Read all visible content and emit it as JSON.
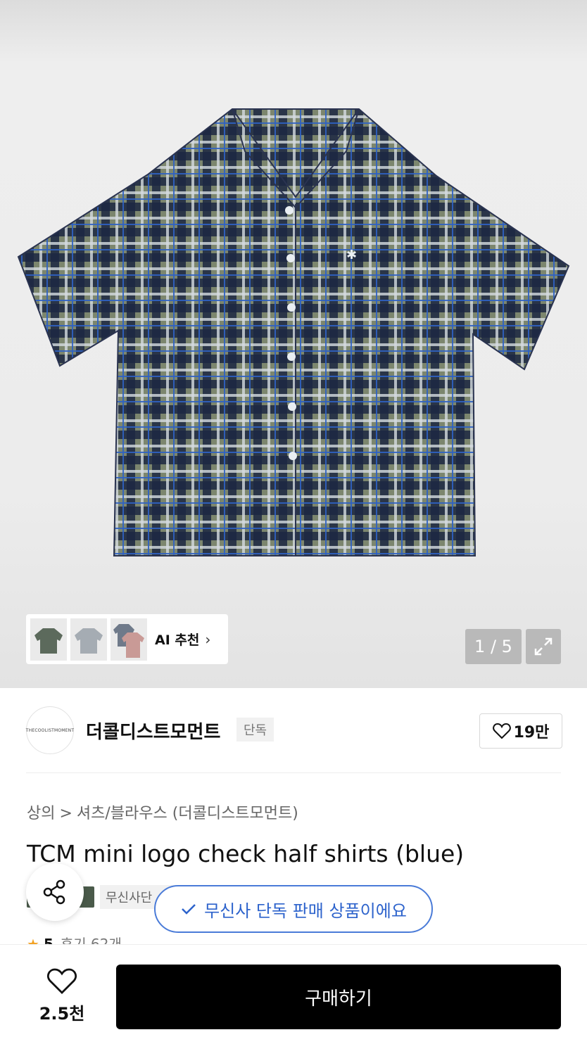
{
  "gallery": {
    "counter": "1 / 5",
    "ai_label": "AI 추천",
    "thumbnails": [
      "thumb-green-shirt",
      "thumb-grey-shirt",
      "thumb-pink-check-shirts"
    ]
  },
  "brand": {
    "logo_text": "THECOOLISTMOMENT",
    "name": "더콜디스트모먼트",
    "badge": "단독",
    "likes": "19만"
  },
  "breadcrumb": {
    "category": "상의",
    "separator": ">",
    "subcategory": "셔츠/블라우스 (더콜디스트모먼트)"
  },
  "product": {
    "title": "TCM mini logo check half shirts (blue)",
    "tag_exclusive": "무신사단",
    "tooltip": "무신사 단독 판매 상품이에요",
    "rating_value": "5",
    "review_text": "후기 62개"
  },
  "bottom_bar": {
    "wish_count": "2.5천",
    "buy_label": "구매하기"
  },
  "colors": {
    "accent_blue": "#2d63cc",
    "buy_button": "#000000",
    "star": "#f2a020"
  }
}
